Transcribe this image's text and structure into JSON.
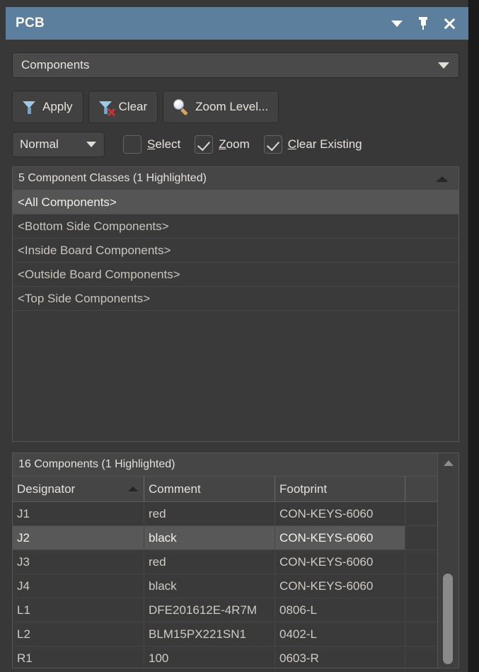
{
  "titlebar": {
    "title": "PCB",
    "icons": [
      "dropdown-arrow-icon",
      "pin-icon",
      "close-icon"
    ]
  },
  "objectkind": {
    "selected": "Components",
    "arrow": "chevron-down-icon"
  },
  "toolbar": {
    "apply_label": "Apply",
    "clear_label": "Clear",
    "zoom_level_label": "Zoom Level...",
    "apply_icon": "filter-funnel-icon",
    "clear_icon": "filter-funnel-clear-icon",
    "zoom_icon": "magnifier-icon"
  },
  "options": {
    "mask_mode": "Normal",
    "checkboxes": [
      {
        "label_prefix": "",
        "mnemonic": "S",
        "label_rest": "elect",
        "checked": false
      },
      {
        "label_prefix": "",
        "mnemonic": "Z",
        "label_rest": "oom",
        "checked": true
      },
      {
        "label_prefix": "",
        "mnemonic": "C",
        "label_rest": "lear Existing",
        "checked": true
      }
    ]
  },
  "classes_panel": {
    "header": "5 Component Classes (1 Highlighted)",
    "collapse_icon": "collapse-up-icon",
    "items": [
      {
        "label": "<All Components>",
        "selected": true
      },
      {
        "label": "<Bottom Side Components>",
        "selected": false
      },
      {
        "label": "<Inside Board Components>",
        "selected": false
      },
      {
        "label": "<Outside Board Components>",
        "selected": false
      },
      {
        "label": "<Top Side Components>",
        "selected": false
      }
    ]
  },
  "components_panel": {
    "header": "16 Components (1 Highlighted)",
    "columns": [
      {
        "label": "Designator",
        "sorted": "asc"
      },
      {
        "label": "Comment",
        "sorted": ""
      },
      {
        "label": "Footprint",
        "sorted": ""
      },
      {
        "label": "",
        "sorted": ""
      }
    ],
    "rows": [
      {
        "designator": "J1",
        "comment": "red",
        "footprint": "CON-KEYS-6060",
        "extra": "",
        "highlighted": false
      },
      {
        "designator": "J2",
        "comment": "black",
        "footprint": "CON-KEYS-6060",
        "extra": "",
        "highlighted": true
      },
      {
        "designator": "J3",
        "comment": "red",
        "footprint": "CON-KEYS-6060",
        "extra": "",
        "highlighted": false
      },
      {
        "designator": "J4",
        "comment": "black",
        "footprint": "CON-KEYS-6060",
        "extra": "",
        "highlighted": false
      },
      {
        "designator": "L1",
        "comment": "DFE201612E-4R7M",
        "footprint": "0806-L",
        "extra": "",
        "highlighted": false
      },
      {
        "designator": "L2",
        "comment": "BLM15PX221SN1",
        "footprint": "0402-L",
        "extra": "",
        "highlighted": false
      },
      {
        "designator": "R1",
        "comment": "100",
        "footprint": "0603-R",
        "extra": "",
        "highlighted": false
      }
    ],
    "scrollbar": {
      "up_icon": "scroll-up-arrow-icon"
    }
  },
  "colors": {
    "titlebar": "#5c7f9e",
    "panel_bg": "#383838",
    "selection": "#585858",
    "text": "#e8e4dd"
  }
}
